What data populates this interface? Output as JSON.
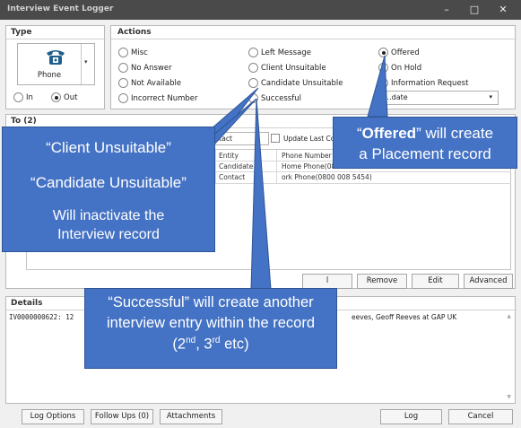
{
  "window": {
    "title": "Interview Event Logger",
    "minimize": "–",
    "maximize": "□",
    "close": "✕"
  },
  "type_panel": {
    "header": "Type",
    "phone_label": "Phone",
    "in_label": "In",
    "out_label": "Out",
    "selected": "Out"
  },
  "actions_panel": {
    "header": "Actions",
    "options": [
      "Misc",
      "No Answer",
      "Not Available",
      "Incorrect Number",
      "Left Message",
      "Client Unsuitable",
      "Candidate Unsuitable",
      "Successful",
      "Offered",
      "On Hold",
      "Information Request"
    ],
    "selected": "Offered",
    "dropdown_value": "...date"
  },
  "to_panel": {
    "header": "To (2)",
    "contact_field": "ontact",
    "update_last_label": "Update Last Co",
    "columns": [
      "Entity",
      "Phone Number"
    ],
    "rows": [
      [
        "Candidate",
        "Home Phone(08"
      ],
      [
        "Contact",
        "ork Phone(0800 008 5454)"
      ]
    ],
    "buttons": {
      "add": "l",
      "remove": "Remove",
      "edit": "Edit",
      "advanced": "Advanced"
    }
  },
  "details_panel": {
    "header": "Details",
    "text_left": "IV0000000622: 12",
    "text_right": "eeves, Geoff Reeves at GAP UK"
  },
  "bottom_bar": {
    "log_options": "Log Options",
    "follow_ups": "Follow Ups (0)",
    "attachments": "Attachments",
    "log": "Log",
    "cancel": "Cancel"
  },
  "callouts": {
    "left": {
      "line1": "“Client Unsuitable”",
      "line2": "“Candidate Unsuitable”",
      "line3": "Will inactivate the",
      "line4": "Interview record"
    },
    "right": {
      "quote_open": "“",
      "bold": "Offered",
      "rest": "” will create",
      "line2": "a Placement record"
    },
    "bottom": {
      "line1": "“Successful” will create another",
      "line2": "interview entry within the record",
      "paren_open": "(2",
      "sup1": "nd",
      "mid": ", 3",
      "sup2": "rd",
      "end": " etc)"
    }
  },
  "colors": {
    "callout_fill": "#4472c4",
    "callout_border": "#2f5597",
    "titlebar": "#4a4a4a"
  }
}
